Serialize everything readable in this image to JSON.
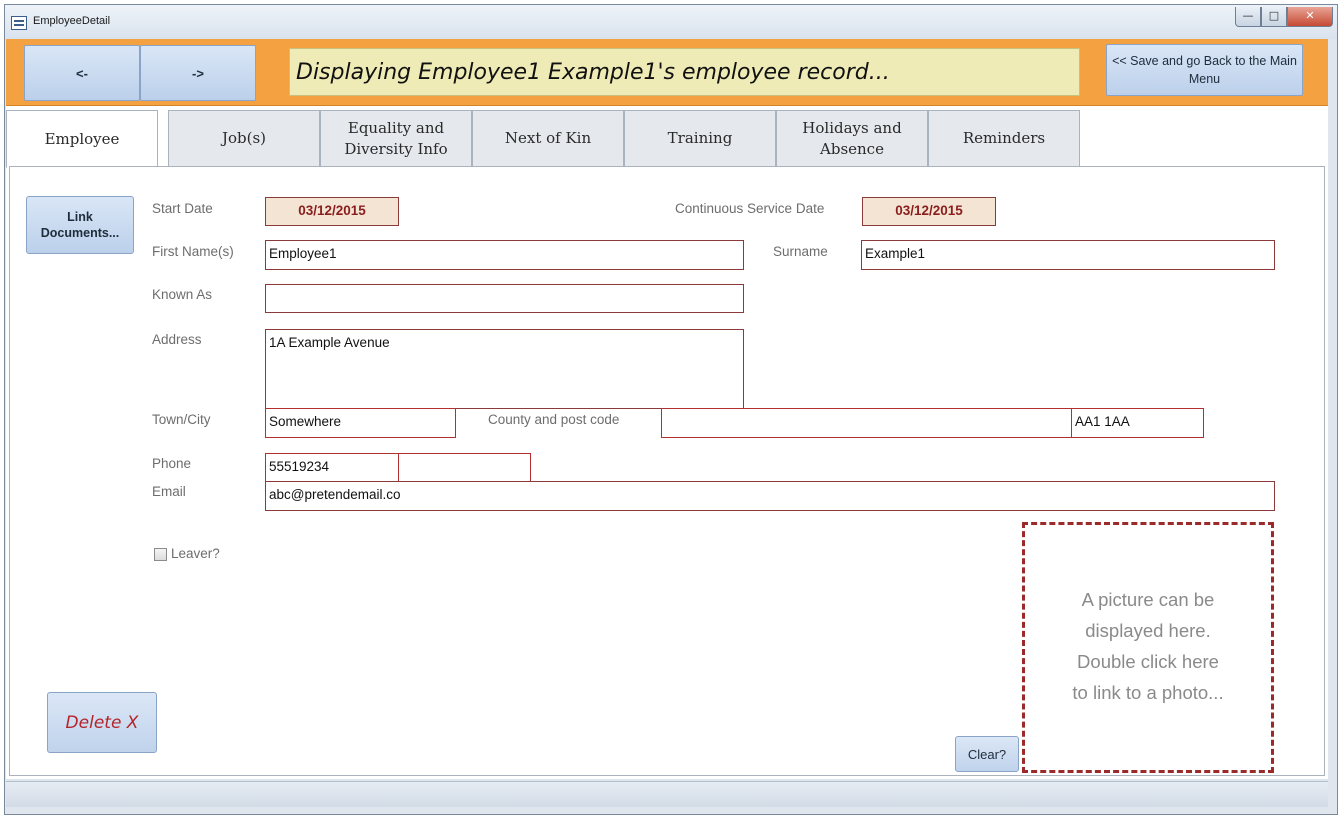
{
  "window": {
    "title": "EmployeeDetail"
  },
  "toolbar": {
    "prev_label": "<-",
    "next_label": "->",
    "banner_text": "Displaying Employee1 Example1's employee record...",
    "save_back_label": "<< Save and go Back to the  Main Menu"
  },
  "tabs": [
    {
      "label": "Employee"
    },
    {
      "label": "Job(s)"
    },
    {
      "label": "Equality and Diversity Info"
    },
    {
      "label": "Next of Kin"
    },
    {
      "label": "Training"
    },
    {
      "label": "Holidays and Absence"
    },
    {
      "label": "Reminders"
    }
  ],
  "form": {
    "link_documents_label": "Link Documents...",
    "start_date_label": "Start Date",
    "start_date": "03/12/2015",
    "continuous_service_label": "Continuous Service Date",
    "continuous_service_date": "03/12/2015",
    "first_name_label": "First Name(s)",
    "first_name": "Employee1",
    "surname_label": "Surname",
    "surname": "Example1",
    "known_as_label": "Known As",
    "known_as": "",
    "address_label": "Address",
    "address": "1A Example Avenue",
    "town_label": "Town/City",
    "town": "Somewhere",
    "county_label": "County and post code",
    "county": "",
    "postcode": "AA1 1AA",
    "phone_label": "Phone",
    "phone": "55519234",
    "phone2": "",
    "email_label": "Email",
    "email": "abc@pretendemail.co",
    "leaver_label": "Leaver?",
    "leaver_checked": false,
    "delete_label": "Delete X",
    "clear_label": "Clear?",
    "photo_placeholder": "A picture can be\ndisplayed here.\nDouble click here\nto link to a photo..."
  },
  "colors": {
    "accent_bar": "#f4a141",
    "banner_bg": "#efebb6",
    "field_border": "#8b3a3a",
    "date_text": "#8a1e1e",
    "delete_text": "#b4242a"
  }
}
